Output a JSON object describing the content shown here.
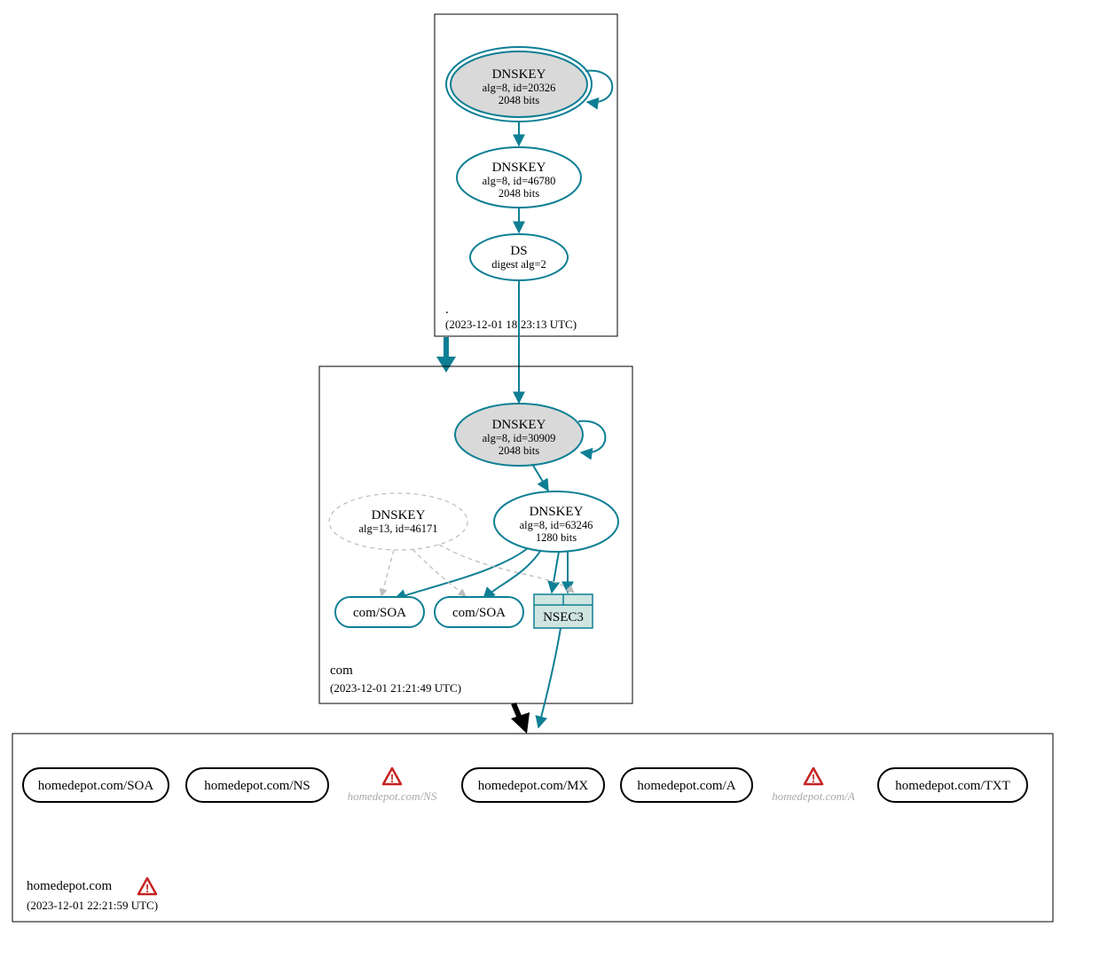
{
  "colors": {
    "teal": "#0e7f94",
    "gray_fill": "#d9d9d9",
    "nsec_fill": "#cfe5e0",
    "warning_red": "#c62222",
    "faded_gray": "#a9a9a9"
  },
  "zones": {
    "root": {
      "name": ".",
      "timestamp": "(2023-12-01 18:23:13 UTC)",
      "dnskey_ksk": {
        "title": "DNSKEY",
        "alg": "alg=8, id=20326",
        "bits": "2048 bits"
      },
      "dnskey_zsk": {
        "title": "DNSKEY",
        "alg": "alg=8, id=46780",
        "bits": "2048 bits"
      },
      "ds": {
        "title": "DS",
        "digest": "digest alg=2"
      }
    },
    "com": {
      "name": "com",
      "timestamp": "(2023-12-01 21:21:49 UTC)",
      "dnskey_ksk": {
        "title": "DNSKEY",
        "alg": "alg=8, id=30909",
        "bits": "2048 bits"
      },
      "dnskey_zsk": {
        "title": "DNSKEY",
        "alg": "alg=8, id=63246",
        "bits": "1280 bits"
      },
      "dnskey_alt": {
        "title": "DNSKEY",
        "alg": "alg=13, id=46171"
      },
      "soa1": "com/SOA",
      "soa2": "com/SOA",
      "nsec3": "NSEC3"
    },
    "homedepot": {
      "name": "homedepot.com",
      "timestamp": "(2023-12-01 22:21:59 UTC)",
      "records": {
        "soa": "homedepot.com/SOA",
        "ns": "homedepot.com/NS",
        "ns_warn": "homedepot.com/NS",
        "mx": "homedepot.com/MX",
        "a": "homedepot.com/A",
        "a_warn": "homedepot.com/A",
        "txt": "homedepot.com/TXT"
      }
    }
  }
}
